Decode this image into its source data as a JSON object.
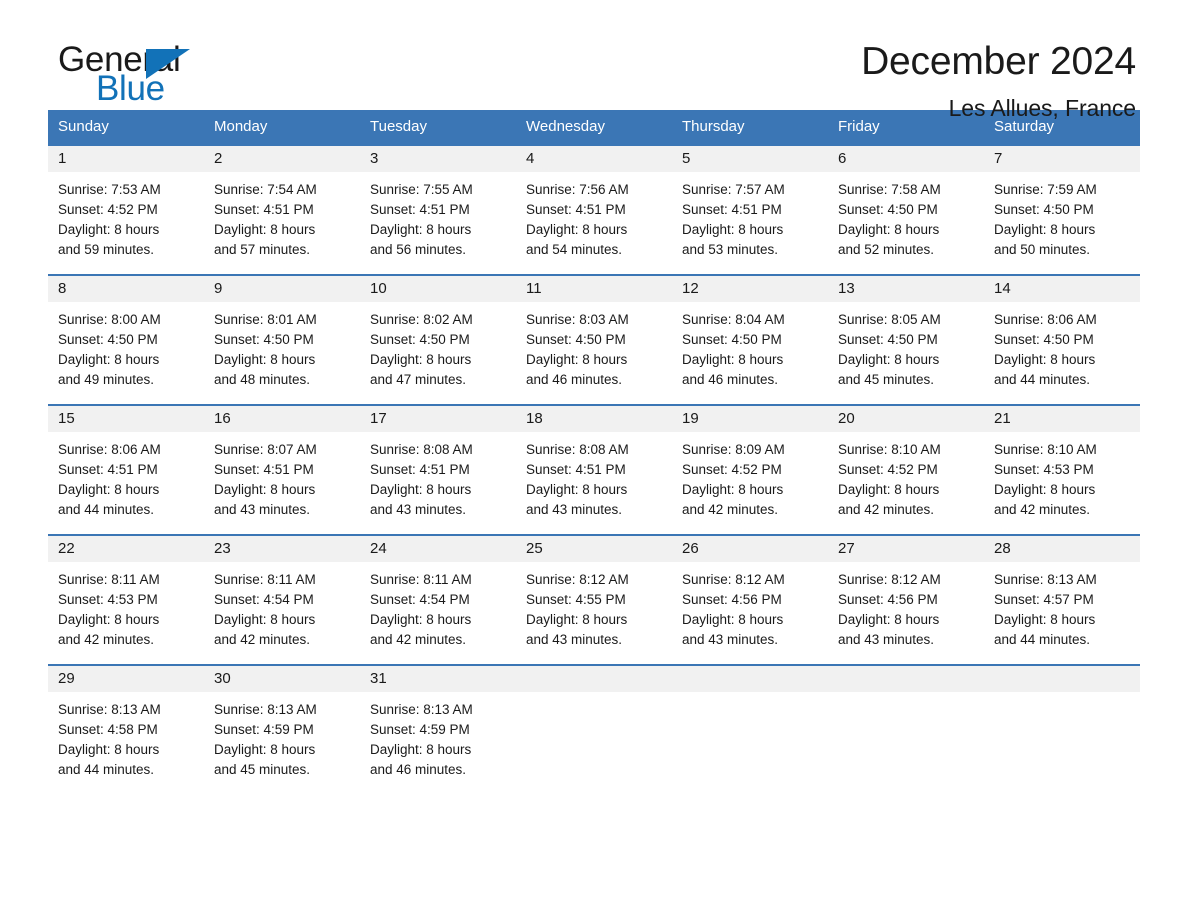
{
  "brand": {
    "name_top": "General",
    "name_bottom": "Blue",
    "accent_color": "#1272b8"
  },
  "header": {
    "title": "December 2024",
    "subtitle": "Les Allues, France"
  },
  "theme": {
    "header_blue": "#3b76b5",
    "daynum_background": "#f1f1f1",
    "page_background": "#ffffff",
    "text_color": "#1a1a1a"
  },
  "calendar": {
    "weekday_headers": [
      "Sunday",
      "Monday",
      "Tuesday",
      "Wednesday",
      "Thursday",
      "Friday",
      "Saturday"
    ],
    "labels": {
      "sunrise_prefix": "Sunrise:",
      "sunset_prefix": "Sunset:",
      "daylight_prefix": "Daylight:"
    },
    "weeks": [
      [
        {
          "day": "1",
          "sunrise": "Sunrise: 7:53 AM",
          "sunset": "Sunset: 4:52 PM",
          "daylight_line1": "Daylight: 8 hours",
          "daylight_line2": "and 59 minutes."
        },
        {
          "day": "2",
          "sunrise": "Sunrise: 7:54 AM",
          "sunset": "Sunset: 4:51 PM",
          "daylight_line1": "Daylight: 8 hours",
          "daylight_line2": "and 57 minutes."
        },
        {
          "day": "3",
          "sunrise": "Sunrise: 7:55 AM",
          "sunset": "Sunset: 4:51 PM",
          "daylight_line1": "Daylight: 8 hours",
          "daylight_line2": "and 56 minutes."
        },
        {
          "day": "4",
          "sunrise": "Sunrise: 7:56 AM",
          "sunset": "Sunset: 4:51 PM",
          "daylight_line1": "Daylight: 8 hours",
          "daylight_line2": "and 54 minutes."
        },
        {
          "day": "5",
          "sunrise": "Sunrise: 7:57 AM",
          "sunset": "Sunset: 4:51 PM",
          "daylight_line1": "Daylight: 8 hours",
          "daylight_line2": "and 53 minutes."
        },
        {
          "day": "6",
          "sunrise": "Sunrise: 7:58 AM",
          "sunset": "Sunset: 4:50 PM",
          "daylight_line1": "Daylight: 8 hours",
          "daylight_line2": "and 52 minutes."
        },
        {
          "day": "7",
          "sunrise": "Sunrise: 7:59 AM",
          "sunset": "Sunset: 4:50 PM",
          "daylight_line1": "Daylight: 8 hours",
          "daylight_line2": "and 50 minutes."
        }
      ],
      [
        {
          "day": "8",
          "sunrise": "Sunrise: 8:00 AM",
          "sunset": "Sunset: 4:50 PM",
          "daylight_line1": "Daylight: 8 hours",
          "daylight_line2": "and 49 minutes."
        },
        {
          "day": "9",
          "sunrise": "Sunrise: 8:01 AM",
          "sunset": "Sunset: 4:50 PM",
          "daylight_line1": "Daylight: 8 hours",
          "daylight_line2": "and 48 minutes."
        },
        {
          "day": "10",
          "sunrise": "Sunrise: 8:02 AM",
          "sunset": "Sunset: 4:50 PM",
          "daylight_line1": "Daylight: 8 hours",
          "daylight_line2": "and 47 minutes."
        },
        {
          "day": "11",
          "sunrise": "Sunrise: 8:03 AM",
          "sunset": "Sunset: 4:50 PM",
          "daylight_line1": "Daylight: 8 hours",
          "daylight_line2": "and 46 minutes."
        },
        {
          "day": "12",
          "sunrise": "Sunrise: 8:04 AM",
          "sunset": "Sunset: 4:50 PM",
          "daylight_line1": "Daylight: 8 hours",
          "daylight_line2": "and 46 minutes."
        },
        {
          "day": "13",
          "sunrise": "Sunrise: 8:05 AM",
          "sunset": "Sunset: 4:50 PM",
          "daylight_line1": "Daylight: 8 hours",
          "daylight_line2": "and 45 minutes."
        },
        {
          "day": "14",
          "sunrise": "Sunrise: 8:06 AM",
          "sunset": "Sunset: 4:50 PM",
          "daylight_line1": "Daylight: 8 hours",
          "daylight_line2": "and 44 minutes."
        }
      ],
      [
        {
          "day": "15",
          "sunrise": "Sunrise: 8:06 AM",
          "sunset": "Sunset: 4:51 PM",
          "daylight_line1": "Daylight: 8 hours",
          "daylight_line2": "and 44 minutes."
        },
        {
          "day": "16",
          "sunrise": "Sunrise: 8:07 AM",
          "sunset": "Sunset: 4:51 PM",
          "daylight_line1": "Daylight: 8 hours",
          "daylight_line2": "and 43 minutes."
        },
        {
          "day": "17",
          "sunrise": "Sunrise: 8:08 AM",
          "sunset": "Sunset: 4:51 PM",
          "daylight_line1": "Daylight: 8 hours",
          "daylight_line2": "and 43 minutes."
        },
        {
          "day": "18",
          "sunrise": "Sunrise: 8:08 AM",
          "sunset": "Sunset: 4:51 PM",
          "daylight_line1": "Daylight: 8 hours",
          "daylight_line2": "and 43 minutes."
        },
        {
          "day": "19",
          "sunrise": "Sunrise: 8:09 AM",
          "sunset": "Sunset: 4:52 PM",
          "daylight_line1": "Daylight: 8 hours",
          "daylight_line2": "and 42 minutes."
        },
        {
          "day": "20",
          "sunrise": "Sunrise: 8:10 AM",
          "sunset": "Sunset: 4:52 PM",
          "daylight_line1": "Daylight: 8 hours",
          "daylight_line2": "and 42 minutes."
        },
        {
          "day": "21",
          "sunrise": "Sunrise: 8:10 AM",
          "sunset": "Sunset: 4:53 PM",
          "daylight_line1": "Daylight: 8 hours",
          "daylight_line2": "and 42 minutes."
        }
      ],
      [
        {
          "day": "22",
          "sunrise": "Sunrise: 8:11 AM",
          "sunset": "Sunset: 4:53 PM",
          "daylight_line1": "Daylight: 8 hours",
          "daylight_line2": "and 42 minutes."
        },
        {
          "day": "23",
          "sunrise": "Sunrise: 8:11 AM",
          "sunset": "Sunset: 4:54 PM",
          "daylight_line1": "Daylight: 8 hours",
          "daylight_line2": "and 42 minutes."
        },
        {
          "day": "24",
          "sunrise": "Sunrise: 8:11 AM",
          "sunset": "Sunset: 4:54 PM",
          "daylight_line1": "Daylight: 8 hours",
          "daylight_line2": "and 42 minutes."
        },
        {
          "day": "25",
          "sunrise": "Sunrise: 8:12 AM",
          "sunset": "Sunset: 4:55 PM",
          "daylight_line1": "Daylight: 8 hours",
          "daylight_line2": "and 43 minutes."
        },
        {
          "day": "26",
          "sunrise": "Sunrise: 8:12 AM",
          "sunset": "Sunset: 4:56 PM",
          "daylight_line1": "Daylight: 8 hours",
          "daylight_line2": "and 43 minutes."
        },
        {
          "day": "27",
          "sunrise": "Sunrise: 8:12 AM",
          "sunset": "Sunset: 4:56 PM",
          "daylight_line1": "Daylight: 8 hours",
          "daylight_line2": "and 43 minutes."
        },
        {
          "day": "28",
          "sunrise": "Sunrise: 8:13 AM",
          "sunset": "Sunset: 4:57 PM",
          "daylight_line1": "Daylight: 8 hours",
          "daylight_line2": "and 44 minutes."
        }
      ],
      [
        {
          "day": "29",
          "sunrise": "Sunrise: 8:13 AM",
          "sunset": "Sunset: 4:58 PM",
          "daylight_line1": "Daylight: 8 hours",
          "daylight_line2": "and 44 minutes."
        },
        {
          "day": "30",
          "sunrise": "Sunrise: 8:13 AM",
          "sunset": "Sunset: 4:59 PM",
          "daylight_line1": "Daylight: 8 hours",
          "daylight_line2": "and 45 minutes."
        },
        {
          "day": "31",
          "sunrise": "Sunrise: 8:13 AM",
          "sunset": "Sunset: 4:59 PM",
          "daylight_line1": "Daylight: 8 hours",
          "daylight_line2": "and 46 minutes."
        },
        {
          "day": "",
          "sunrise": "",
          "sunset": "",
          "daylight_line1": "",
          "daylight_line2": ""
        },
        {
          "day": "",
          "sunrise": "",
          "sunset": "",
          "daylight_line1": "",
          "daylight_line2": ""
        },
        {
          "day": "",
          "sunrise": "",
          "sunset": "",
          "daylight_line1": "",
          "daylight_line2": ""
        },
        {
          "day": "",
          "sunrise": "",
          "sunset": "",
          "daylight_line1": "",
          "daylight_line2": ""
        }
      ]
    ]
  }
}
